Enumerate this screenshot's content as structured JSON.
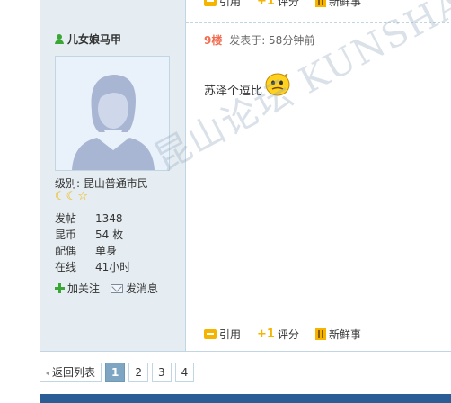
{
  "post": {
    "top_actions": [
      "引用",
      "评分",
      "新鲜事"
    ],
    "user": {
      "name": "儿女娘马甲",
      "level": "级别: 昆山普通市民",
      "stats": [
        {
          "label": "发帖",
          "value": "1348"
        },
        {
          "label": "昆币",
          "value": "54 枚"
        },
        {
          "label": "配偶",
          "value": "单身"
        },
        {
          "label": "在线",
          "value": "41小时"
        }
      ],
      "links": {
        "follow": "加关注",
        "message": "发消息"
      }
    },
    "floor": "9楼",
    "posted": "发表于: 58分钟前",
    "content": "苏泽个逗比",
    "bottom_actions": {
      "quote": "引用",
      "rate": "评分",
      "fresh": "新鲜事"
    }
  },
  "pager": {
    "back": "返回列表",
    "pages": [
      "1",
      "2",
      "3",
      "4"
    ],
    "current": "1"
  },
  "watermark": "昆山论坛 KUNSHAN BBS",
  "colors": {
    "floor": "#f26c4f",
    "sidebar": "#e5edf2",
    "border": "#c2d5e3",
    "accent": "#f4b400",
    "footer": "#2b5d95"
  }
}
